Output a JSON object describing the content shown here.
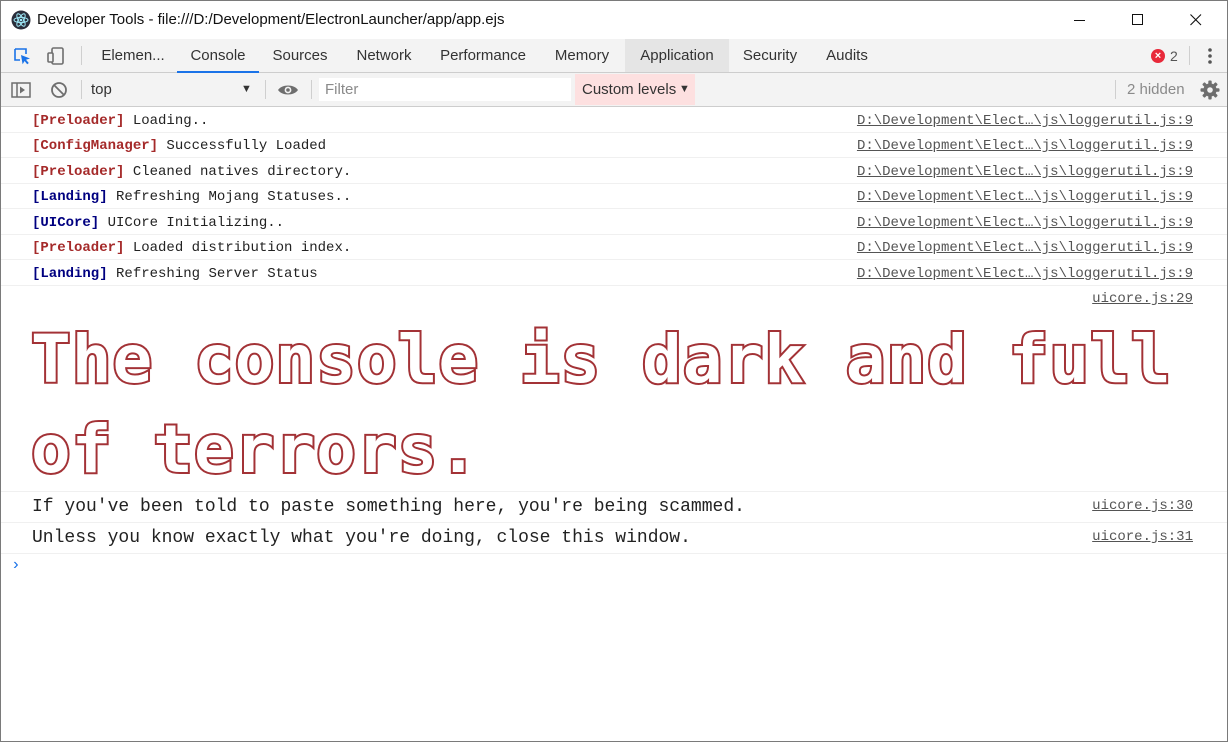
{
  "window": {
    "title": "Developer Tools - file:///D:/Development/ElectronLauncher/app/app.ejs"
  },
  "tabs": [
    {
      "label": "Elemen..."
    },
    {
      "label": "Console"
    },
    {
      "label": "Sources"
    },
    {
      "label": "Network"
    },
    {
      "label": "Performance"
    },
    {
      "label": "Memory"
    },
    {
      "label": "Application"
    },
    {
      "label": "Security"
    },
    {
      "label": "Audits"
    }
  ],
  "active_tab": "Console",
  "error_count": "2",
  "toolbar": {
    "context": "top",
    "filter_placeholder": "Filter",
    "levels_label": "Custom levels",
    "hidden": "2 hidden"
  },
  "messages": [
    {
      "tag": "[Preloader]",
      "tag_color": "#a52a2a",
      "text": " Loading..",
      "source": "D:\\Development\\Elect…\\js\\loggerutil.js:9"
    },
    {
      "tag": "[ConfigManager]",
      "tag_color": "#a52a2a",
      "text": " Successfully Loaded",
      "source": "D:\\Development\\Elect…\\js\\loggerutil.js:9"
    },
    {
      "tag": "[Preloader]",
      "tag_color": "#a52a2a",
      "text": " Cleaned natives directory.",
      "source": "D:\\Development\\Elect…\\js\\loggerutil.js:9"
    },
    {
      "tag": "[Landing]",
      "tag_color": "#000080",
      "text": " Refreshing Mojang Statuses..",
      "source": "D:\\Development\\Elect…\\js\\loggerutil.js:9"
    },
    {
      "tag": "[UICore]",
      "tag_color": "#000080",
      "text": " UICore Initializing..",
      "source": "D:\\Development\\Elect…\\js\\loggerutil.js:9"
    },
    {
      "tag": "[Preloader]",
      "tag_color": "#a52a2a",
      "text": " Loaded distribution index.",
      "source": "D:\\Development\\Elect…\\js\\loggerutil.js:9"
    },
    {
      "tag": "[Landing]",
      "tag_color": "#000080",
      "text": " Refreshing Server Status",
      "source": "D:\\Development\\Elect…\\js\\loggerutil.js:9"
    }
  ],
  "warning": {
    "big_text": "The console is dark and full of terrors.",
    "big_source": "uicore.js:29",
    "line1": "If you've been told to paste something here, you're being scammed.",
    "line1_source": "uicore.js:30",
    "line2": "Unless you know exactly what you're doing, close this window.",
    "line2_source": "uicore.js:31"
  },
  "prompt_symbol": "›",
  "colors": {
    "accent": "#1a73e8",
    "warning_red": "#a33236",
    "error_red": "#e8293a",
    "levels_bg": "#fde0e0"
  }
}
